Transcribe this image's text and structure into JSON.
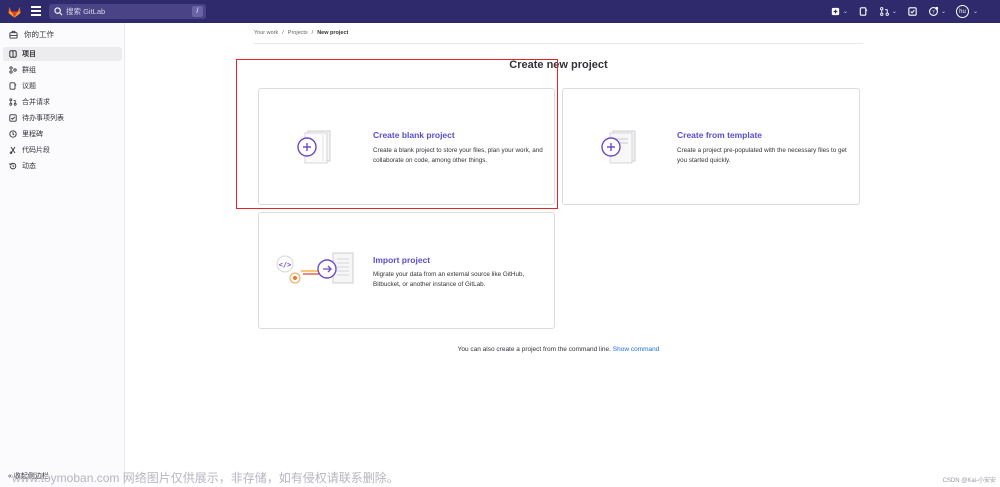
{
  "topbar": {
    "search_placeholder": "搜索 GitLab",
    "search_shortcut": "/",
    "avatar_initials": "hu",
    "icons": [
      "gitlab-logo-icon",
      "hamburger-menu-icon",
      "search-icon",
      "issues-icon",
      "merge-request-icon",
      "todo-icon",
      "help-icon",
      "avatar"
    ]
  },
  "sidebar": {
    "header": "你的工作",
    "items": [
      {
        "label": "项目",
        "icon": "project-icon",
        "active": true
      },
      {
        "label": "群组",
        "icon": "group-icon",
        "active": false
      },
      {
        "label": "议题",
        "icon": "issues-icon",
        "active": false
      },
      {
        "label": "合并请求",
        "icon": "merge-request-icon",
        "active": false
      },
      {
        "label": "待办事项列表",
        "icon": "todo-icon",
        "active": false
      },
      {
        "label": "里程碑",
        "icon": "milestone-icon",
        "active": false
      },
      {
        "label": "代码片段",
        "icon": "snippet-icon",
        "active": false
      },
      {
        "label": "动态",
        "icon": "activity-icon",
        "active": false
      }
    ],
    "collapse_label": "收起侧边栏"
  },
  "breadcrumb": [
    "Your work",
    "Projects",
    "New project"
  ],
  "page_title": "Create new project",
  "cards": {
    "blank": {
      "title": "Create blank project",
      "description": "Create a blank project to store your files, plan your work, and collaborate on code, among other things."
    },
    "template": {
      "title": "Create from template",
      "description": "Create a project pre-populated with the necessary files to get you started quickly."
    },
    "import": {
      "title": "Import project",
      "description": "Migrate your data from an external source like GitHub, Bitbucket, or another instance of GitLab."
    }
  },
  "cli": {
    "text": "You can also create a project from the command line.",
    "link": "Show command"
  },
  "watermark": "www.toymoban.com 网络图片仅供展示，非存储，如有侵权请联系删除。",
  "credit": "CSDN @Kai-小安安",
  "colors": {
    "topbar": "#2f2a6b",
    "accent": "#5a4ccc",
    "highlight": "#e0262b"
  }
}
